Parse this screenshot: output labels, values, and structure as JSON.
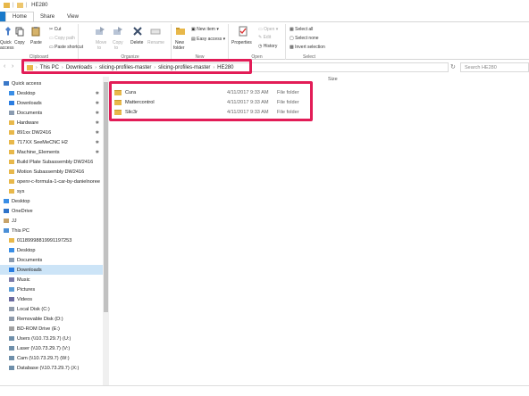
{
  "window": {
    "title": "HE280"
  },
  "ribbon_tabs": [
    "Home",
    "Share",
    "View"
  ],
  "ribbon": {
    "clipboard": {
      "label": "Clipboard",
      "quick_access": "Quick",
      "quick_access2": "access",
      "copy": "Copy",
      "paste": "Paste",
      "cut": "Cut",
      "copy_path": "Copy path",
      "paste_shortcut": "Paste shortcut"
    },
    "organize": {
      "label": "Organize",
      "move_to": "Move",
      "move_to2": "to",
      "copy_to": "Copy",
      "copy_to2": "to",
      "delete": "Delete",
      "rename": "Rename"
    },
    "new": {
      "label": "New",
      "new_folder": "New",
      "new_folder2": "folder",
      "new_item": "New item",
      "easy_access": "Easy access"
    },
    "open": {
      "label": "Open",
      "properties": "Properties",
      "open": "Open",
      "edit": "Edit",
      "history": "History"
    },
    "select": {
      "label": "Select",
      "select_all": "Select all",
      "select_none": "Select none",
      "invert": "Invert selection"
    }
  },
  "breadcrumb": [
    "This PC",
    "Downloads",
    "slicing-profiles-master",
    "slicing-profiles-master",
    "HE280"
  ],
  "search": {
    "placeholder": "Search HE280"
  },
  "columns": {
    "size": "Size"
  },
  "files": [
    {
      "name": "Cura",
      "date": "4/11/2017 9:33 AM",
      "type": "File folder"
    },
    {
      "name": "Mattercontrol",
      "date": "4/11/2017 9:33 AM",
      "type": "File folder"
    },
    {
      "name": "Slic3r",
      "date": "4/11/2017 9:33 AM",
      "type": "File folder"
    }
  ],
  "sidebar": [
    {
      "label": "Quick access",
      "icon": "star-icon",
      "pinned": false
    },
    {
      "label": "Desktop",
      "icon": "desktop-icon",
      "pinned": true
    },
    {
      "label": "Downloads",
      "icon": "download-icon",
      "pinned": true
    },
    {
      "label": "Documents",
      "icon": "documents-icon",
      "pinned": true
    },
    {
      "label": "Hardware",
      "icon": "folder-icon",
      "pinned": true
    },
    {
      "label": "891xx DW2416",
      "icon": "folder-icon",
      "pinned": true
    },
    {
      "label": "717XX SeeMeCNC H2",
      "icon": "folder-icon",
      "pinned": true
    },
    {
      "label": "Machine_Elements",
      "icon": "folder-icon",
      "pinned": true
    },
    {
      "label": "Build Plate Subassembly DW2416",
      "icon": "folder-icon",
      "pinned": false
    },
    {
      "label": "Motion Subassembly DW2416",
      "icon": "folder-icon",
      "pinned": false
    },
    {
      "label": "openr-c-formula-1-car-by-danielnoree",
      "icon": "folder-icon",
      "pinned": false
    },
    {
      "label": "sys",
      "icon": "folder-icon",
      "pinned": false
    },
    {
      "label": "Desktop",
      "icon": "desktop-icon",
      "pinned": false
    },
    {
      "label": "OneDrive",
      "icon": "cloud-icon",
      "pinned": false
    },
    {
      "label": "JJ",
      "icon": "user-icon",
      "pinned": false
    },
    {
      "label": "This PC",
      "icon": "pc-icon",
      "pinned": false
    },
    {
      "label": "01189998819991197253",
      "icon": "folder-icon",
      "pinned": false
    },
    {
      "label": "Desktop",
      "icon": "desktop-icon",
      "pinned": false
    },
    {
      "label": "Documents",
      "icon": "documents-icon",
      "pinned": false
    },
    {
      "label": "Downloads",
      "icon": "download-icon",
      "pinned": false
    },
    {
      "label": "Music",
      "icon": "music-icon",
      "pinned": false
    },
    {
      "label": "Pictures",
      "icon": "pictures-icon",
      "pinned": false
    },
    {
      "label": "Videos",
      "icon": "videos-icon",
      "pinned": false
    },
    {
      "label": "Local Disk (C:)",
      "icon": "drive-icon",
      "pinned": false
    },
    {
      "label": "Removable Disk (D:)",
      "icon": "drive-icon",
      "pinned": false
    },
    {
      "label": "BD-ROM Drive (E:)",
      "icon": "disc-icon",
      "pinned": false
    },
    {
      "label": "Users (\\\\10.73.29.7) (U:)",
      "icon": "network-drive-icon",
      "pinned": false
    },
    {
      "label": "Laser (\\\\10.73.29.7) (V:)",
      "icon": "network-drive-icon",
      "pinned": false
    },
    {
      "label": "Cam (\\\\10.73.29.7) (W:)",
      "icon": "network-drive-icon",
      "pinned": false
    },
    {
      "label": "Database (\\\\10.73.29.7) (X:)",
      "icon": "network-drive-icon",
      "pinned": false
    }
  ],
  "selected_sidebar_index": 19,
  "colors": {
    "accent": "#1979ca",
    "highlight": "#e21c57",
    "folder": "#e8b84a",
    "selected": "#cce4f7"
  }
}
